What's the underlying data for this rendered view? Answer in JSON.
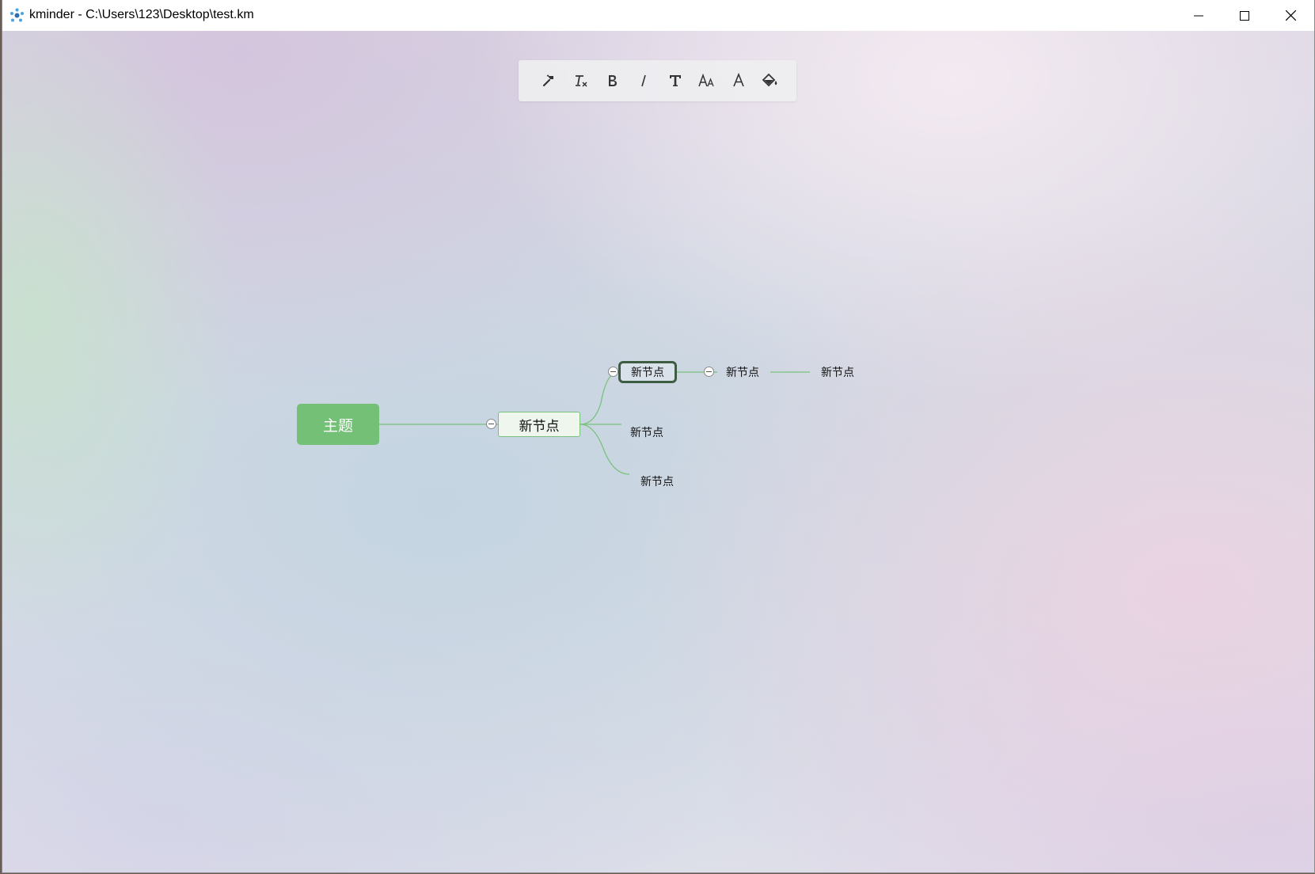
{
  "window": {
    "title": "kminder - C:\\Users\\123\\Desktop\\test.km",
    "icon": "kminder-logo-icon",
    "controls": [
      "minimize-icon",
      "maximize-icon",
      "close-icon"
    ]
  },
  "toolbar": {
    "buttons": [
      {
        "icon": "format-painter-icon",
        "tooltip": ""
      },
      {
        "icon": "clear-format-icon",
        "tooltip": ""
      },
      {
        "icon": "bold-icon",
        "glyph": "B"
      },
      {
        "icon": "italic-icon",
        "glyph": "I"
      },
      {
        "icon": "font-family-icon",
        "glyph": "T"
      },
      {
        "icon": "font-size-icon",
        "glyph": "AA"
      },
      {
        "icon": "font-color-icon",
        "glyph": "A"
      },
      {
        "icon": "background-color-icon"
      }
    ]
  },
  "mindmap": {
    "root": "主题",
    "level1": "新节点",
    "children": {
      "selected": "新节点",
      "second": "新节点",
      "third": "新节点"
    },
    "grandchild": "新节点",
    "great_grandchild": "新节点",
    "colors": {
      "root_fill": "#73c076",
      "link": "#79c27c",
      "selected_border": "#3d5c41"
    }
  }
}
